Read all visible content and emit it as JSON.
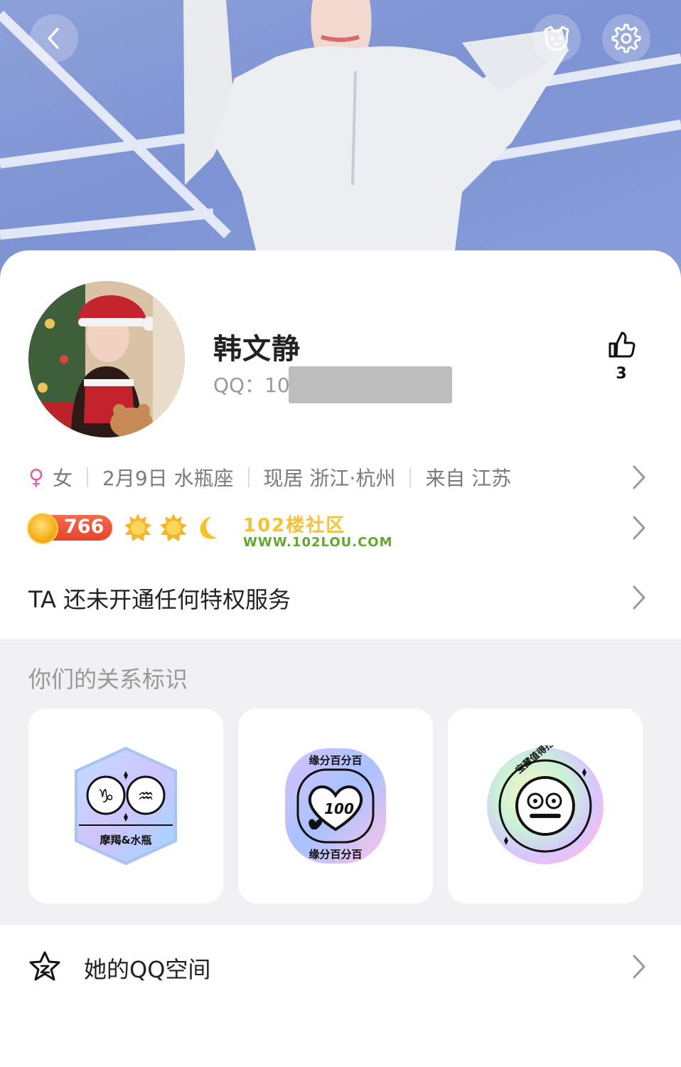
{
  "profile": {
    "nickname": "韩文静",
    "qq_label": "QQ：",
    "qq_visible": "104",
    "likes": "3"
  },
  "info": {
    "gender_symbol": "♀",
    "gender": "女",
    "birthday": "2月9日 水瓶座",
    "location": "现居 浙江·杭州",
    "hometown": "来自 江苏"
  },
  "level": {
    "value": "766",
    "icons": [
      "sun-icon",
      "sun-icon",
      "moon-icon"
    ]
  },
  "watermark": {
    "line1": "102楼社区",
    "line2": "WWW.102LOU.COM"
  },
  "privilege": {
    "text": "TA 还未开通任何特权服务"
  },
  "relationship": {
    "title": "你们的关系标识",
    "badges": [
      {
        "name": "zodiac-badge",
        "label": "摩羯&水瓶"
      },
      {
        "name": "fate-percent-badge",
        "label": "缘分百分百",
        "number": "100"
      },
      {
        "name": "treasure-badge",
        "label": "宝藏值得挖掘"
      }
    ]
  },
  "qzone": {
    "label": "她的QQ空间"
  },
  "colors": {
    "accent_level": "#e7432c",
    "gender": "#e15fa8",
    "background_section": "#f1f1f3"
  }
}
